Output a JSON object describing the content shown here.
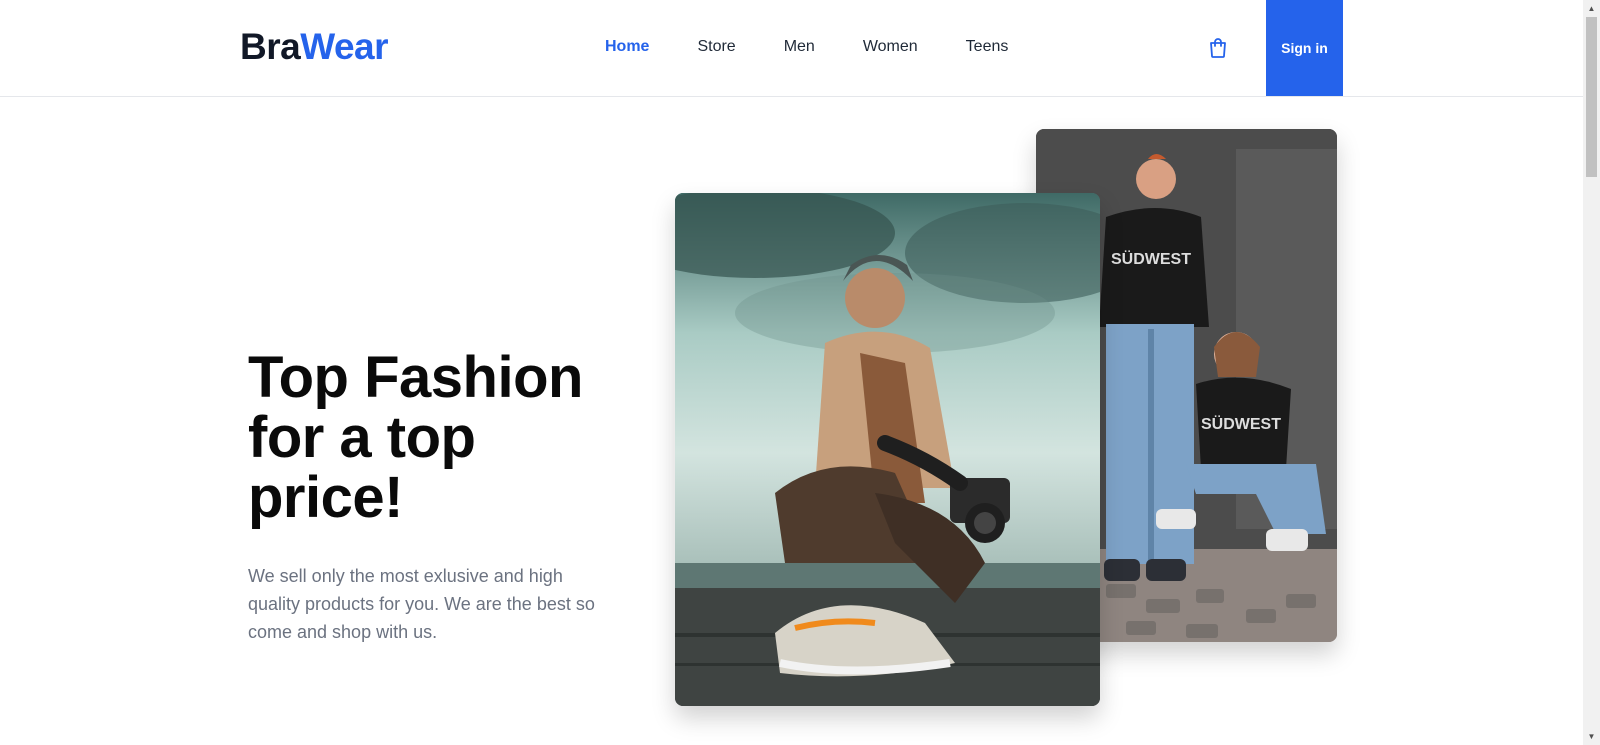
{
  "brand": {
    "part1": "Bra",
    "part2": "Wear"
  },
  "nav": {
    "items": [
      {
        "label": "Home",
        "active": true
      },
      {
        "label": "Store",
        "active": false
      },
      {
        "label": "Men",
        "active": false
      },
      {
        "label": "Women",
        "active": false
      },
      {
        "label": "Teens",
        "active": false
      }
    ]
  },
  "header": {
    "cart_icon": "shopping-bag-icon",
    "signin_label": "Sign in"
  },
  "hero": {
    "title": "Top Fashion for a top price!",
    "description": "We sell only the most exlusive and high quality products for you. We are the best so come and shop with us."
  },
  "colors": {
    "accent": "#2563eb",
    "text": "#111827",
    "muted": "#6b7280"
  }
}
